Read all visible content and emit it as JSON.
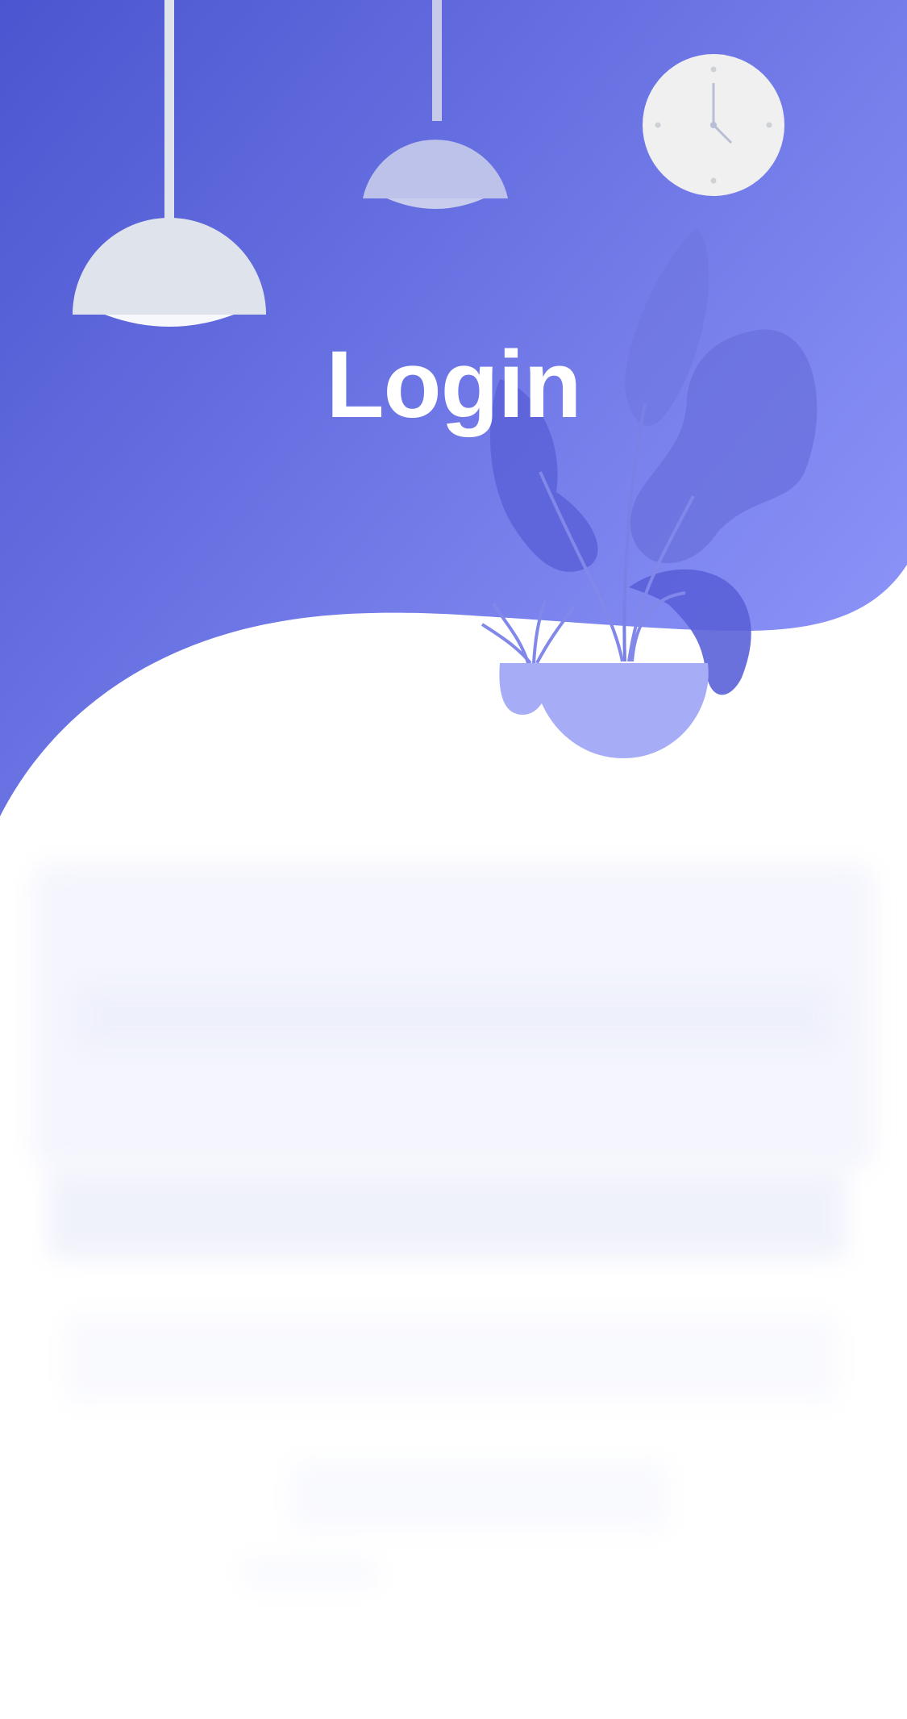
{
  "screen": {
    "title": "Login"
  },
  "colors": {
    "gradient_start": "#4b55cf",
    "gradient_end": "#8b93f8",
    "title": "#ffffff",
    "lamp": "#dfe3ec",
    "clock_face": "#f0f0f0",
    "plant_dark": "#5a61d8",
    "pot": "#a6acf5"
  },
  "icons": {
    "lamp_left": "pendant-lamp-icon",
    "lamp_middle": "pendant-lamp-icon",
    "clock": "wall-clock-icon",
    "plant": "potted-plant-icon",
    "small_plant": "potted-plant-icon"
  }
}
